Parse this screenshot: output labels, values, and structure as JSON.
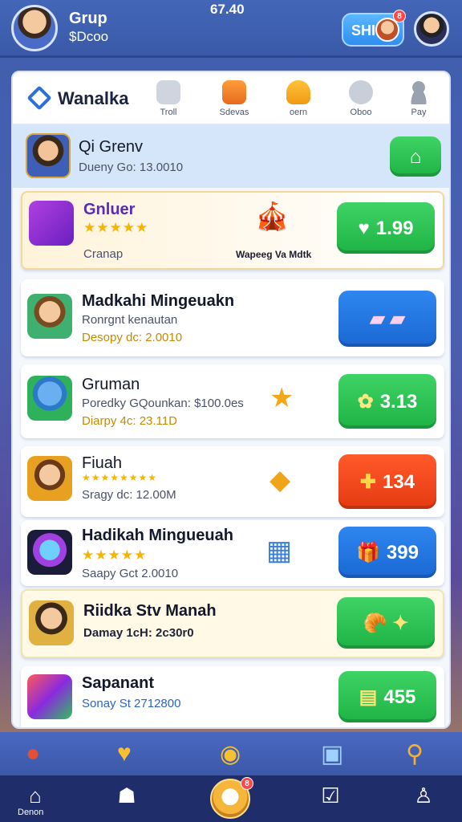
{
  "topbar": {
    "player_name": "Grup",
    "player_coins": "$Dcoo",
    "center_value": "67.40",
    "shop_label": "SHI",
    "shop_badge": "8"
  },
  "header": {
    "brand": "Wanalka",
    "tabs": [
      {
        "label": "Troll",
        "icon": "grid-icon"
      },
      {
        "label": "Sdevas",
        "icon": "gift-box-icon"
      },
      {
        "label": "oern",
        "icon": "bell-icon"
      },
      {
        "label": "Oboo",
        "icon": "minus-icon"
      },
      {
        "label": "Pay",
        "icon": "user-icon"
      }
    ]
  },
  "rows": [
    {
      "title": "Qi Grenv",
      "subtitle": "Dueny Go: 13.0010",
      "button": {
        "value": "",
        "glyph": "⌂",
        "color": "#27c04f"
      }
    },
    {
      "title": "Gnluer",
      "stars": "★★★★★",
      "subtitle": "Cranap",
      "promo_caption": "Wapeeg Va Mdtk",
      "button": {
        "value": "1.99",
        "glyph": "♥",
        "color": "#27c04f"
      }
    },
    {
      "title": "Madkahi Mingeuakn",
      "subtitle": "Ronrgnt kenautan",
      "subtitle2": "Desopy dc: 2.0010",
      "button": {
        "value": "",
        "glyph": "▰ ▰",
        "color": "#1f72e0"
      }
    },
    {
      "title": "Gruman",
      "subtitle": "Poredky GQounkan: $100.0es",
      "subtitle2": "Diarpy 4c: 23.11D",
      "button": {
        "value": "3.13",
        "glyph": "✿",
        "color": "#27c04f"
      }
    },
    {
      "title": "Fiuah",
      "stars": "★★★★★★★★",
      "subtitle": "Sragy dc: 12.00M",
      "button": {
        "value": "134",
        "glyph": "✚",
        "color": "#f04818"
      }
    },
    {
      "title": "Hadikah Mingueuah",
      "stars": "★★★★★",
      "subtitle": "Saapy Gct 2.0010",
      "button": {
        "value": "399",
        "glyph": "🎁",
        "color": "#1f72e0"
      }
    },
    {
      "title": "Riidka Stv Manah",
      "subtitle": "Damay 1cH: 2c30r0",
      "button": {
        "value": "",
        "glyph": "🥐 ✦",
        "color": "#27c04f"
      }
    },
    {
      "title": "Sapanant",
      "subtitle": "Sonay St 2712800",
      "button": {
        "value": "455",
        "glyph": "▤",
        "color": "#27c04f"
      }
    }
  ],
  "bottom_nav": {
    "home_label": "Denon",
    "center_badge": "8"
  }
}
